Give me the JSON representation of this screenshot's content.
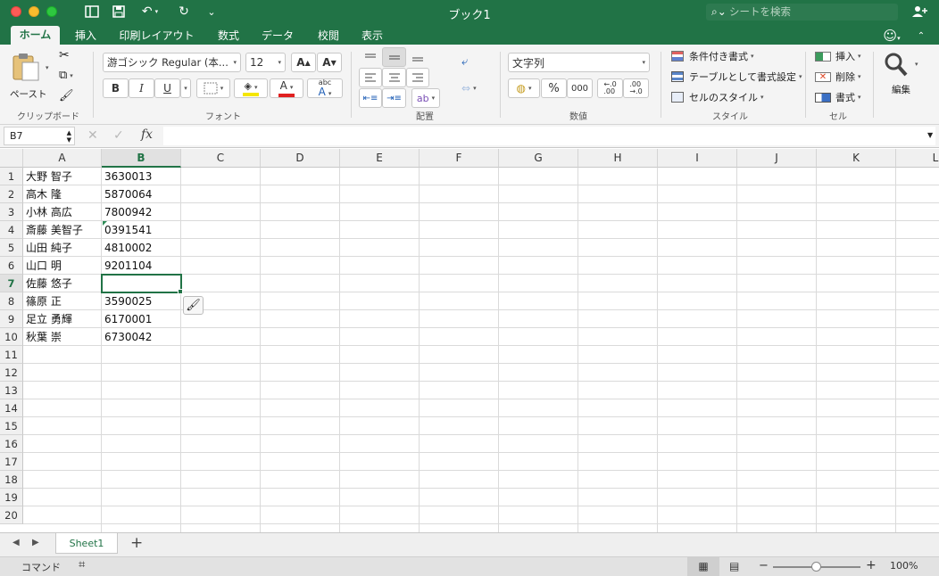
{
  "window": {
    "title": "ブック1"
  },
  "search": {
    "placeholder": "シートを検索"
  },
  "tabs": [
    "ホーム",
    "挿入",
    "印刷レイアウト",
    "数式",
    "データ",
    "校閲",
    "表示"
  ],
  "ribbon": {
    "clipboard": {
      "paste": "ペースト",
      "label": "クリップボード"
    },
    "font": {
      "name": "游ゴシック Regular (本...",
      "size": "12",
      "label": "フォント",
      "bold": "B",
      "italic": "I",
      "underline": "U",
      "phonetic": "abc"
    },
    "alignment": {
      "label": "配置"
    },
    "number": {
      "format": "文字列",
      "label": "数値",
      "percent": "%",
      "thousands": "000"
    },
    "styles": {
      "conditional": "条件付き書式",
      "table": "テーブルとして書式設定",
      "cell": "セルのスタイル",
      "label": "スタイル"
    },
    "cells": {
      "insert": "挿入",
      "delete": "削除",
      "format": "書式",
      "label": "セル"
    },
    "editing": {
      "label": "編集"
    }
  },
  "formula": {
    "name_box": "B7",
    "fx": "fx",
    "value": ""
  },
  "columns": [
    "A",
    "B",
    "C",
    "D",
    "E",
    "F",
    "G",
    "H",
    "I",
    "J",
    "K",
    "L"
  ],
  "rows": [
    "1",
    "2",
    "3",
    "4",
    "5",
    "6",
    "7",
    "8",
    "9",
    "10",
    "11",
    "12",
    "13",
    "14",
    "15",
    "16",
    "17",
    "18",
    "19",
    "20"
  ],
  "cells": [
    {
      "name": "大野 智子",
      "code": "3630013"
    },
    {
      "name": "高木 隆",
      "code": "5870064"
    },
    {
      "name": "小林 高広",
      "code": "7800942"
    },
    {
      "name": "斎藤 美智子",
      "code": "0391541"
    },
    {
      "name": "山田 純子",
      "code": "4810002"
    },
    {
      "name": "山口 明",
      "code": "9201104"
    },
    {
      "name": "佐藤 悠子",
      "code": ""
    },
    {
      "name": "篠原 正",
      "code": "3590025"
    },
    {
      "name": "足立 勇輝",
      "code": "6170001"
    },
    {
      "name": "秋葉 崇",
      "code": "6730042"
    }
  ],
  "selection": {
    "column": "B",
    "row": "7"
  },
  "sheets": [
    "Sheet1"
  ],
  "status": {
    "mode": "コマンド",
    "zoom": "100%"
  },
  "colors": {
    "accent": "#217346"
  }
}
